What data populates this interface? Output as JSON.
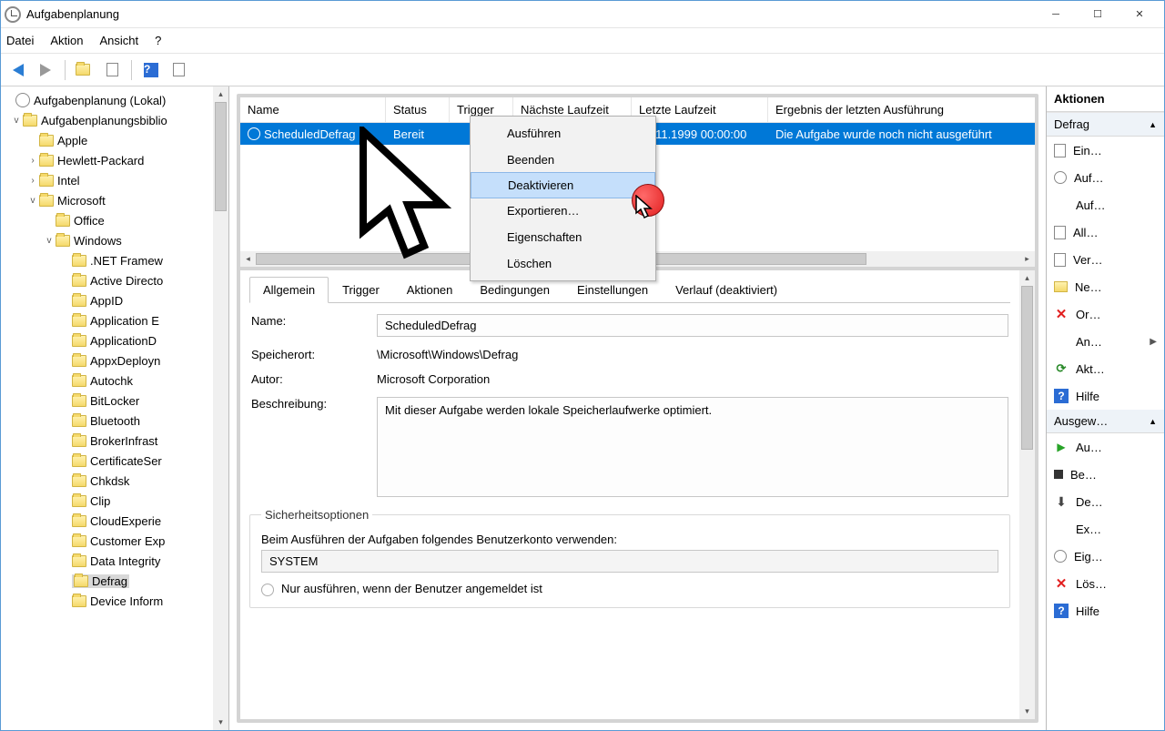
{
  "window": {
    "title": "Aufgabenplanung"
  },
  "menubar": {
    "file": "Datei",
    "action": "Aktion",
    "view": "Ansicht",
    "help": "?"
  },
  "tree": {
    "root": "Aufgabenplanung (Lokal)",
    "library": "Aufgabenplanungsbiblio",
    "items": {
      "apple": "Apple",
      "hp": "Hewlett-Packard",
      "intel": "Intel",
      "microsoft": "Microsoft",
      "office": "Office",
      "windows": "Windows",
      "net": ".NET Framew",
      "ad": "Active Directo",
      "appid": "AppID",
      "appe": "Application E",
      "appd": "ApplicationD",
      "appx": "AppxDeployn",
      "autochk": "Autochk",
      "bitlocker": "BitLocker",
      "bluetooth": "Bluetooth",
      "broker": "BrokerInfrast",
      "certif": "CertificateSer",
      "chkdsk": "Chkdsk",
      "clip": "Clip",
      "cloud": "CloudExperie",
      "customer": "Customer Exp",
      "datai": "Data Integrity",
      "defrag": "Defrag",
      "device": "Device Inform"
    }
  },
  "table": {
    "headers": {
      "name": "Name",
      "status": "Status",
      "trigger": "Trigger",
      "next": "Nächste Laufzeit",
      "last": "Letzte Laufzeit",
      "result": "Ergebnis der letzten Ausführung"
    },
    "row": {
      "name": "ScheduledDefrag",
      "status": "Bereit",
      "trigger": "",
      "next": "",
      "last": "30.11.1999 00:00:00",
      "result": "Die Aufgabe wurde noch nicht ausgeführt"
    }
  },
  "context_menu": {
    "run": "Ausführen",
    "end": "Beenden",
    "disable": "Deaktivieren",
    "export": "Exportieren…",
    "props": "Eigenschaften",
    "delete": "Löschen"
  },
  "tabs": {
    "general": "Allgemein",
    "trigger": "Trigger",
    "actions": "Aktionen",
    "conditions": "Bedingungen",
    "settings": "Einstellungen",
    "history": "Verlauf (deaktiviert)"
  },
  "details": {
    "name_lbl": "Name:",
    "name_val": "ScheduledDefrag",
    "location_lbl": "Speicherort:",
    "location_val": "\\Microsoft\\Windows\\Defrag",
    "author_lbl": "Autor:",
    "author_val": "Microsoft Corporation",
    "desc_lbl": "Beschreibung:",
    "desc_val": "Mit dieser Aufgabe werden lokale Speicherlaufwerke optimiert.",
    "security_legend": "Sicherheitsoptionen",
    "security_user_note": "Beim Ausführen der Aufgaben folgendes Benutzerkonto verwenden:",
    "security_user": "SYSTEM",
    "radio1": "Nur ausführen, wenn der Benutzer angemeldet ist"
  },
  "actions": {
    "title": "Aktionen",
    "group1": "Defrag",
    "g1": {
      "ein": "Ein…",
      "auf": "Auf…",
      "auf2": "Auf…",
      "all": "All…",
      "ver": "Ver…",
      "ne": "Ne…",
      "or": "Or…",
      "an": "An…",
      "akt": "Akt…",
      "hilfe": "Hilfe"
    },
    "group2": "Ausgew…",
    "g2": {
      "au": "Au…",
      "be": "Be…",
      "de": "De…",
      "ex": "Ex…",
      "eig": "Eig…",
      "los": "Lös…",
      "hilfe": "Hilfe"
    }
  }
}
